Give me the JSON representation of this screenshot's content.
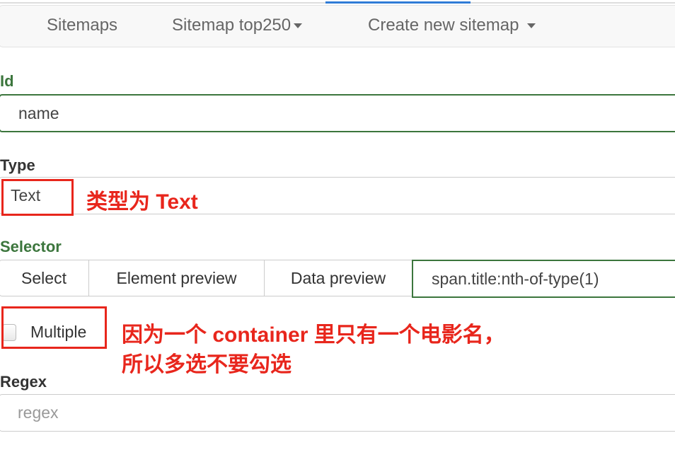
{
  "navbar": {
    "items": [
      {
        "label": "Sitemaps"
      },
      {
        "label": "Sitemap top250",
        "dropdown": true
      },
      {
        "label": "Create new sitemap",
        "dropdown": true
      }
    ]
  },
  "form": {
    "id": {
      "label": "Id",
      "value": "name"
    },
    "type": {
      "label": "Type",
      "value": "Text"
    },
    "selector": {
      "label": "Selector",
      "buttons": [
        "Select",
        "Element preview",
        "Data preview"
      ],
      "value": "span.title:nth-of-type(1)"
    },
    "multiple": {
      "label": "Multiple",
      "checked": false
    },
    "regex": {
      "label": "Regex",
      "placeholder": "regex"
    }
  },
  "annotations": {
    "type_note": "类型为 Text",
    "multiple_note_line1": "因为一个 container 里只有一个电影名，",
    "multiple_note_line2": "所以多选不要勾选"
  },
  "colors": {
    "valid_green": "#3c763d",
    "annotation_red": "#e8261c",
    "active_tab_blue": "#2f7bd6"
  }
}
